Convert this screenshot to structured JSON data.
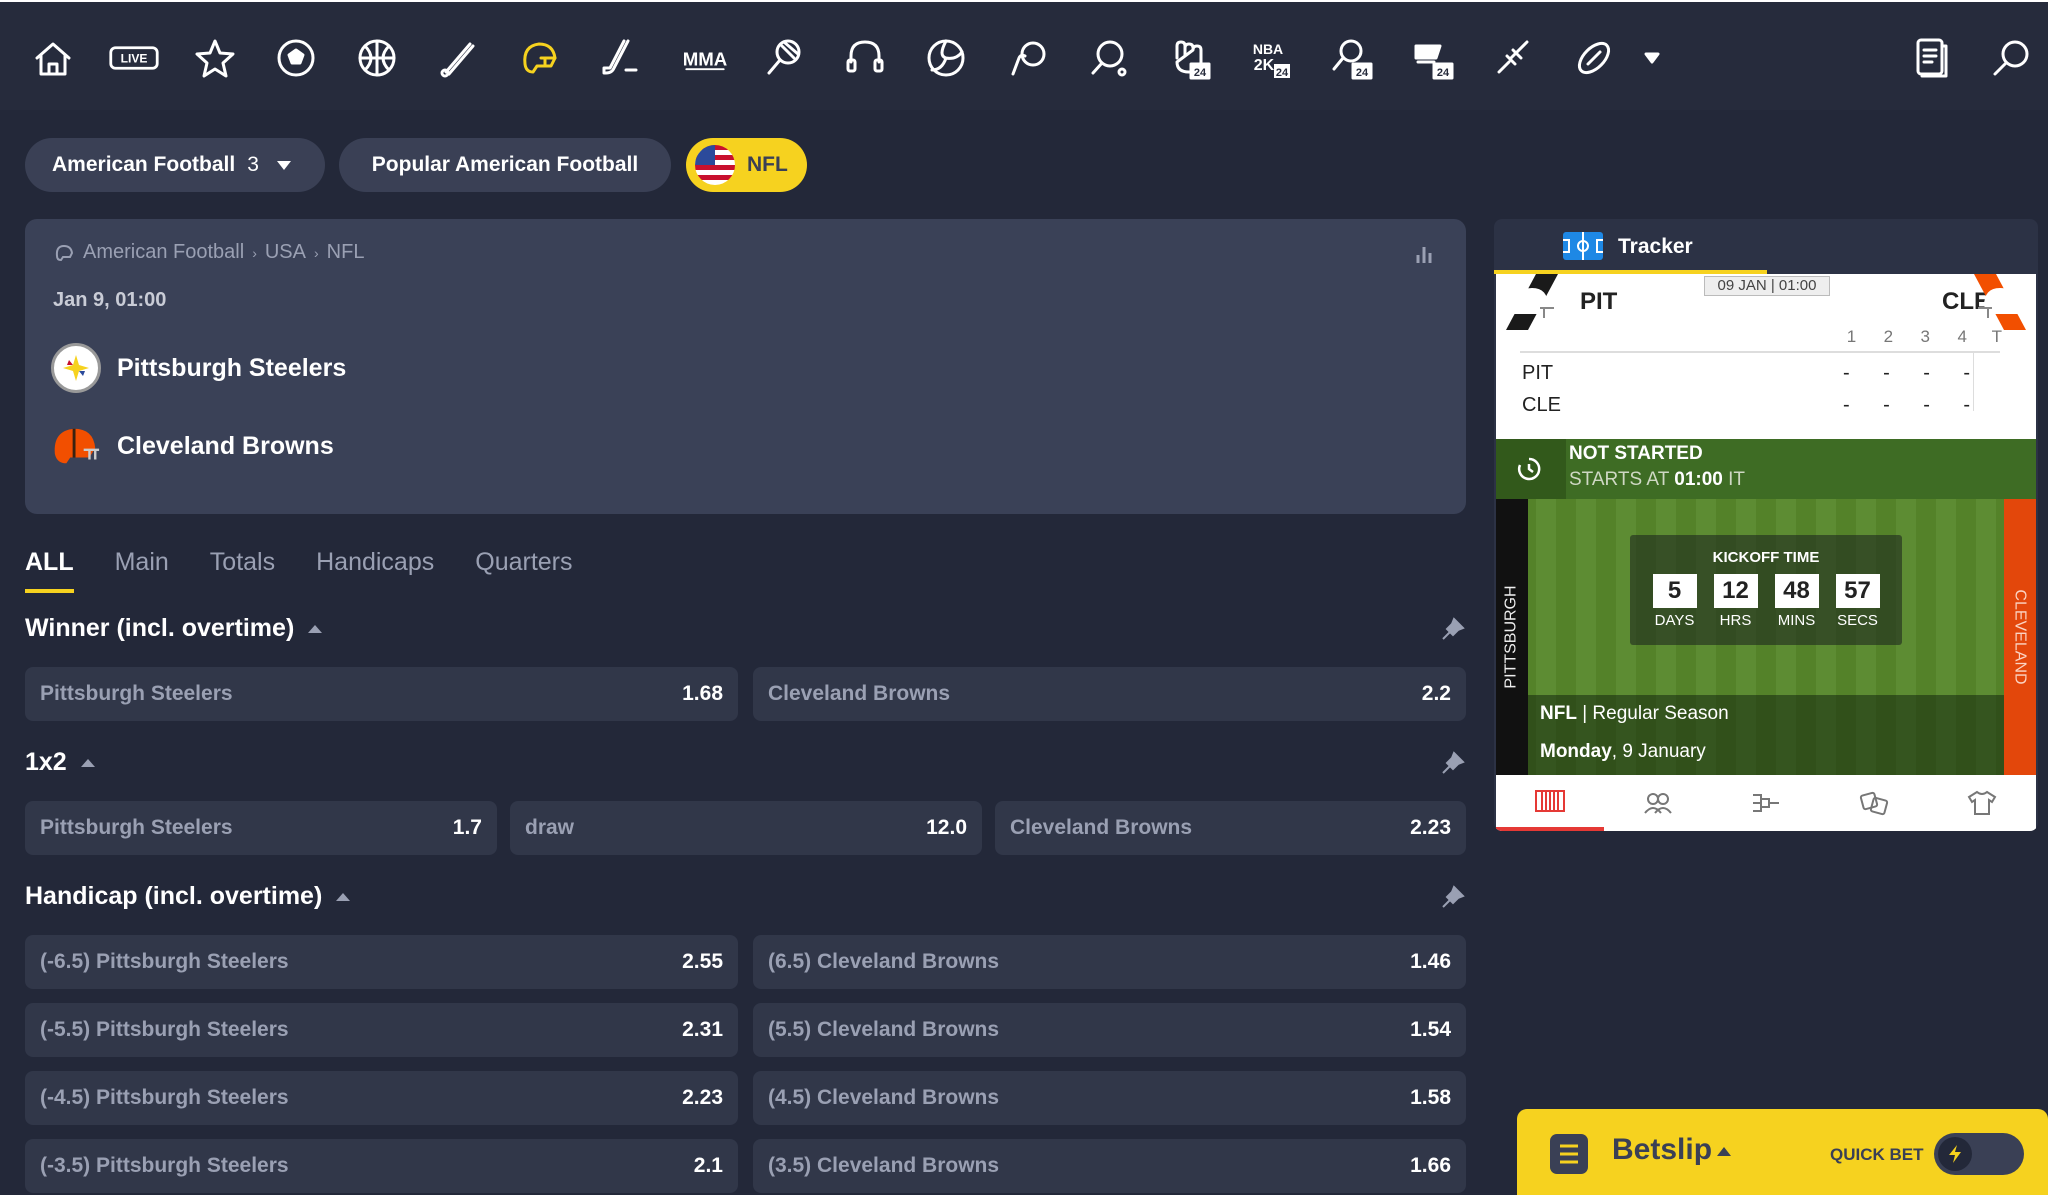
{
  "nav": {
    "icons": [
      "home-icon",
      "live-icon",
      "star-icon",
      "soccer-icon",
      "basketball-icon",
      "baseball-icon",
      "american-football-icon",
      "hockey-icon",
      "mma-icon",
      "tennis-icon",
      "esports-icon",
      "volleyball-icon",
      "handball-icon",
      "table-tennis-icon",
      "boxing-24-icon",
      "nba2k-24-icon",
      "tennis-24-icon",
      "ice-hockey-24-icon",
      "darts-icon",
      "rugby-icon",
      "more-dropdown-icon"
    ],
    "live_label": "LIVE",
    "mma_label": "MMA",
    "nba_label": "NBA",
    "twok_label": "2K",
    "badge_24": "24"
  },
  "filters": {
    "sport": "American Football",
    "sport_count": "3",
    "popular": "Popular American Football",
    "league": "NFL"
  },
  "event": {
    "breadcrumb": [
      "American Football",
      "USA",
      "NFL"
    ],
    "date": "Jan 9, 01:00",
    "home": "Pittsburgh Steelers",
    "away": "Cleveland Browns"
  },
  "tabs": [
    "ALL",
    "Main",
    "Totals",
    "Handicaps",
    "Quarters"
  ],
  "markets": {
    "winner": {
      "title": "Winner (incl. overtime)",
      "odds": [
        {
          "label": "Pittsburgh Steelers",
          "val": "1.68"
        },
        {
          "label": "Cleveland Browns",
          "val": "2.2"
        }
      ]
    },
    "onex2": {
      "title": "1x2",
      "odds": [
        {
          "label": "Pittsburgh Steelers",
          "val": "1.7"
        },
        {
          "label": "draw",
          "val": "12.0"
        },
        {
          "label": "Cleveland Browns",
          "val": "2.23"
        }
      ]
    },
    "handicap": {
      "title": "Handicap (incl. overtime)",
      "rows": [
        [
          {
            "label": "(-6.5) Pittsburgh Steelers",
            "val": "2.55"
          },
          {
            "label": "(6.5) Cleveland Browns",
            "val": "1.46"
          }
        ],
        [
          {
            "label": "(-5.5) Pittsburgh Steelers",
            "val": "2.31"
          },
          {
            "label": "(5.5) Cleveland Browns",
            "val": "1.54"
          }
        ],
        [
          {
            "label": "(-4.5) Pittsburgh Steelers",
            "val": "2.23"
          },
          {
            "label": "(4.5) Cleveland Browns",
            "val": "1.58"
          }
        ],
        [
          {
            "label": "(-3.5) Pittsburgh Steelers",
            "val": "2.1"
          },
          {
            "label": "(3.5) Cleveland Browns",
            "val": "1.66"
          }
        ]
      ]
    }
  },
  "tracker": {
    "title": "Tracker",
    "home_abbr": "PIT",
    "away_abbr": "CLE",
    "date": "09 JAN | 01:00",
    "quarters": [
      "1",
      "2",
      "3",
      "4",
      "T"
    ],
    "rows": [
      {
        "team": "PIT",
        "scores": [
          "-",
          "-",
          "-",
          "-",
          ""
        ]
      },
      {
        "team": "CLE",
        "scores": [
          "-",
          "-",
          "-",
          "-",
          ""
        ]
      }
    ],
    "status": "NOT STARTED",
    "starts_prefix": "STARTS AT",
    "starts_time": "01:00",
    "starts_suffix": "IT",
    "kickoff_label": "KICKOFF TIME",
    "countdown": [
      {
        "v": "5",
        "u": "DAYS"
      },
      {
        "v": "12",
        "u": "HRS"
      },
      {
        "v": "48",
        "u": "MINS"
      },
      {
        "v": "57",
        "u": "SECS"
      }
    ],
    "home_endzone": "PITTSBURGH",
    "away_endzone": "CLEVELAND",
    "league": "NFL",
    "season": "| Regular Season",
    "day": "Monday",
    "day_date": ", 9 January"
  },
  "betslip": {
    "label": "Betslip",
    "quick": "QUICK BET"
  },
  "colors": {
    "accent": "#f6d21f",
    "bg": "#232839",
    "card": "#3a4157"
  }
}
